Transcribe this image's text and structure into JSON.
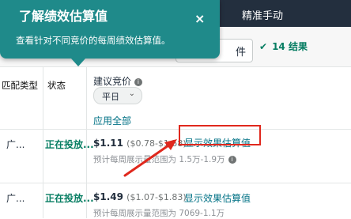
{
  "topbar": {
    "title": "精准手动"
  },
  "toolbar": {
    "filter_suffix": "件",
    "results": "14 结果"
  },
  "header": {
    "col_match_type": "匹配类型",
    "col_status": "状态",
    "col_bid": "建议竞价",
    "weekday": "平日",
    "apply_all": "应用全部"
  },
  "rows": [
    {
      "match": "广...",
      "status": "正在投放...",
      "price": "$1.11",
      "range": "($0.78-$1.58)",
      "link": "显示效果估算值",
      "estimate": "预计每周展示量范围为 1.5万-1.9万"
    },
    {
      "match": "广...",
      "status": "正在投放...",
      "price": "$1.49",
      "range": "($1.07-$1.83)",
      "link": "显示效果估算值",
      "estimate": "预计每周展示量范围为 7069-1.1万"
    }
  ],
  "tooltip": {
    "title": "了解绩效估算值",
    "description": "查看针对不同竞价的每周绩效估算值。",
    "close": "×"
  },
  "icons": {
    "close": "close-icon",
    "info": "info-icon",
    "chevron": "chevron-down-icon",
    "check": "check-icon",
    "arrow": "arrow-annotation-icon"
  },
  "colors": {
    "accent": "#1f8a8a",
    "link": "#007185",
    "status_green": "#067d62",
    "annotation_red": "#e0281d"
  }
}
